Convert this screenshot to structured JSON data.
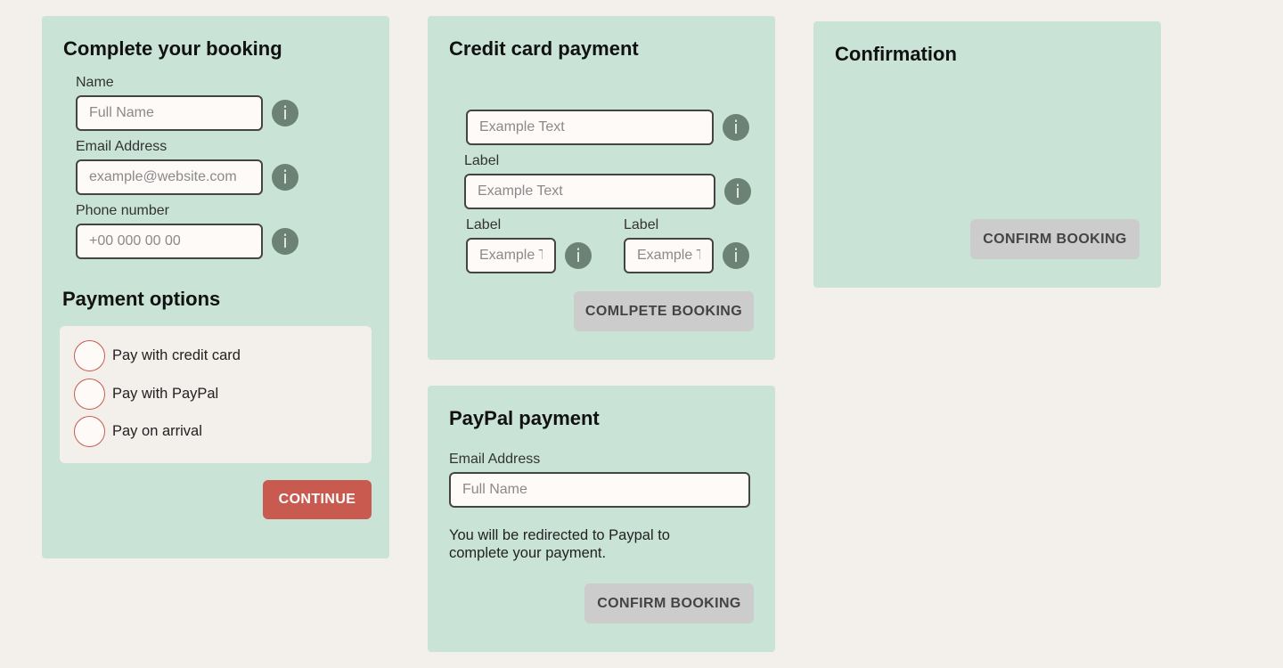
{
  "booking": {
    "title": "Complete your booking",
    "name_label": "Name",
    "name_placeholder": "Full Name",
    "email_label": "Email Address",
    "email_placeholder": "example@website.com",
    "phone_label": "Phone number",
    "phone_placeholder": "+00 000 00 00",
    "info_glyph": "i",
    "payment_title": "Payment options",
    "options": [
      "Pay with credit card",
      "Pay with PayPal",
      "Pay on arrival"
    ],
    "continue_label": "CONTINUE"
  },
  "credit_card": {
    "title": "Credit card payment",
    "field1_placeholder": "Example Text",
    "field2_label": "Label",
    "field2_placeholder": "Example Text",
    "field3_label": "Label",
    "field3_placeholder": "Example Text",
    "field4_label": "Label",
    "field4_placeholder": "Example Text",
    "info_glyph": "i",
    "button_label": "COMLPETE BOOKING"
  },
  "paypal": {
    "title": "PayPal payment",
    "email_label": "Email Address",
    "email_placeholder": "Full Name",
    "note": "You will be redirected to Paypal to complete your payment.",
    "button_label": "CONFIRM BOOKING"
  },
  "confirmation": {
    "title": "Confirmation",
    "button_label": "CONFIRM BOOKING"
  },
  "colors": {
    "page_background": "#f3efea",
    "card_background": "#c9e4d7",
    "accent": "#c85a50",
    "info_icon": "#6b8275",
    "disabled_button": "#cccccc"
  }
}
